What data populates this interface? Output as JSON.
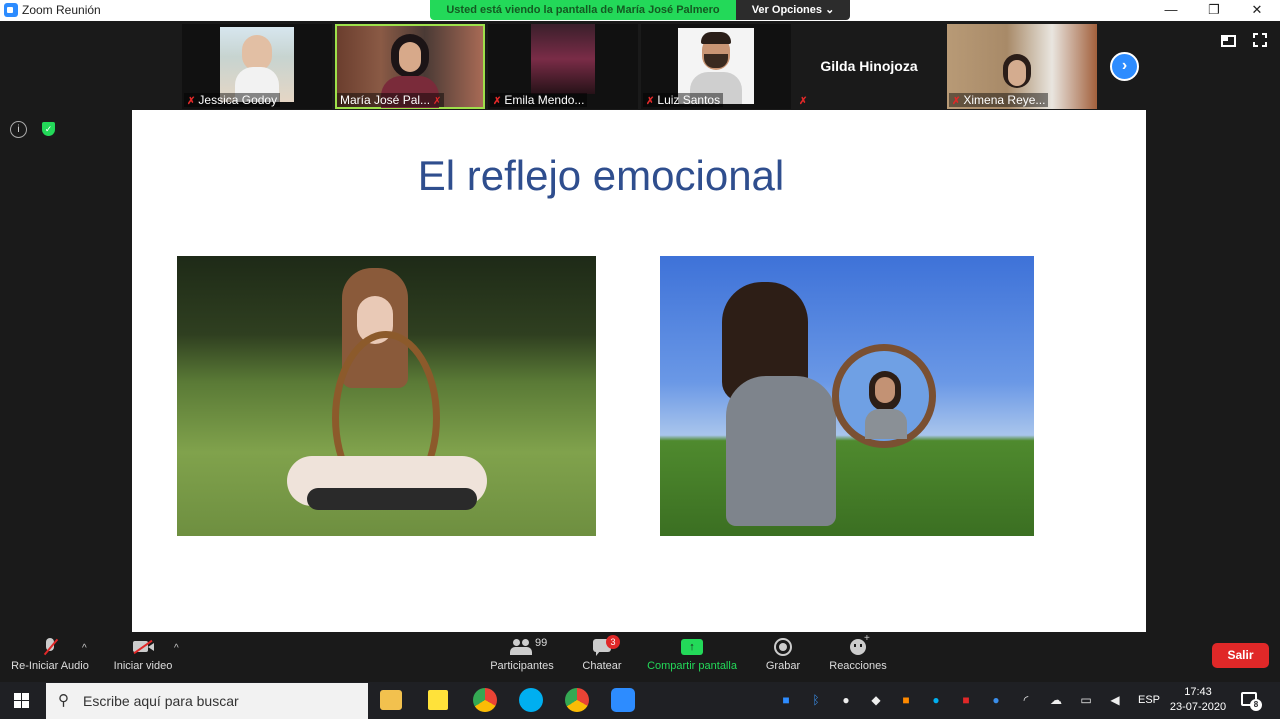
{
  "window": {
    "title": "Zoom Reunión",
    "minimize": "—",
    "restore": "❐",
    "close": "✕"
  },
  "share_banner": {
    "message": "Usted está viendo la pantalla de María José Palmero",
    "options": "Ver Opciones"
  },
  "participants": [
    {
      "name": "Jessica Godoy"
    },
    {
      "name": "María José Pal..."
    },
    {
      "name": "Emila Mendo..."
    },
    {
      "name": "Luiz Santos"
    },
    {
      "name": "Gilda Hinojoza"
    },
    {
      "name": "Ximena Reye..."
    }
  ],
  "slide": {
    "title": "El reflejo emocional"
  },
  "controls": {
    "audio": "Re-Iniciar Audio",
    "video": "Iniciar video",
    "participants": "Participantes",
    "participants_count": "99",
    "chat": "Chatear",
    "chat_badge": "3",
    "share": "Compartir pantalla",
    "record": "Grabar",
    "reactions": "Reacciones",
    "leave": "Salir"
  },
  "taskbar": {
    "search_placeholder": "Escribe aquí para buscar",
    "language": "ESP",
    "time": "17:43",
    "date": "23-07-2020",
    "notifications": "8"
  },
  "colors": {
    "share_green": "#23d959",
    "leave_red": "#e02828",
    "slide_title": "#2f4e8e",
    "accent_blue": "#2d8cff"
  }
}
